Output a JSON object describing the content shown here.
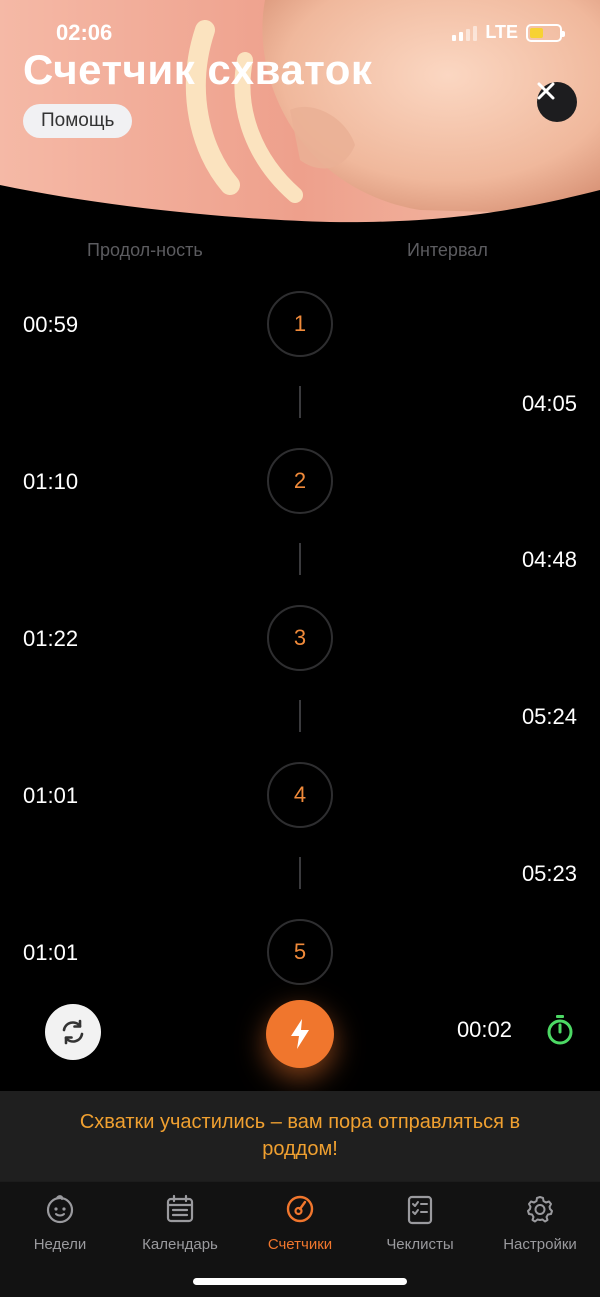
{
  "status": {
    "time": "02:06",
    "network": "LTE"
  },
  "header": {
    "title": "Счетчик схваток",
    "help_label": "Помощь"
  },
  "columns": {
    "duration": "Продол-ность",
    "interval": "Интервал"
  },
  "contractions": [
    {
      "number": "1",
      "duration": "00:59"
    },
    {
      "number": "2",
      "duration": "01:10"
    },
    {
      "number": "3",
      "duration": "01:22"
    },
    {
      "number": "4",
      "duration": "01:01"
    },
    {
      "number": "5",
      "duration": "01:01"
    }
  ],
  "intervals": [
    "04:05",
    "04:48",
    "05:24",
    "05:23"
  ],
  "controls": {
    "timer": "00:02"
  },
  "alert": {
    "text": "Схватки участились – вам пора отправляться в роддом!"
  },
  "tabs": [
    {
      "label": "Недели",
      "icon": "baby-face-icon"
    },
    {
      "label": "Календарь",
      "icon": "calendar-icon"
    },
    {
      "label": "Счетчики",
      "icon": "counter-dial-icon",
      "active": true
    },
    {
      "label": "Чеклисты",
      "icon": "checklist-icon"
    },
    {
      "label": "Настройки",
      "icon": "gear-icon"
    }
  ],
  "colors": {
    "accent": "#f0762d",
    "alert_text": "#f0a030",
    "number": "#f08a3a",
    "stopwatch": "#4cd964"
  }
}
